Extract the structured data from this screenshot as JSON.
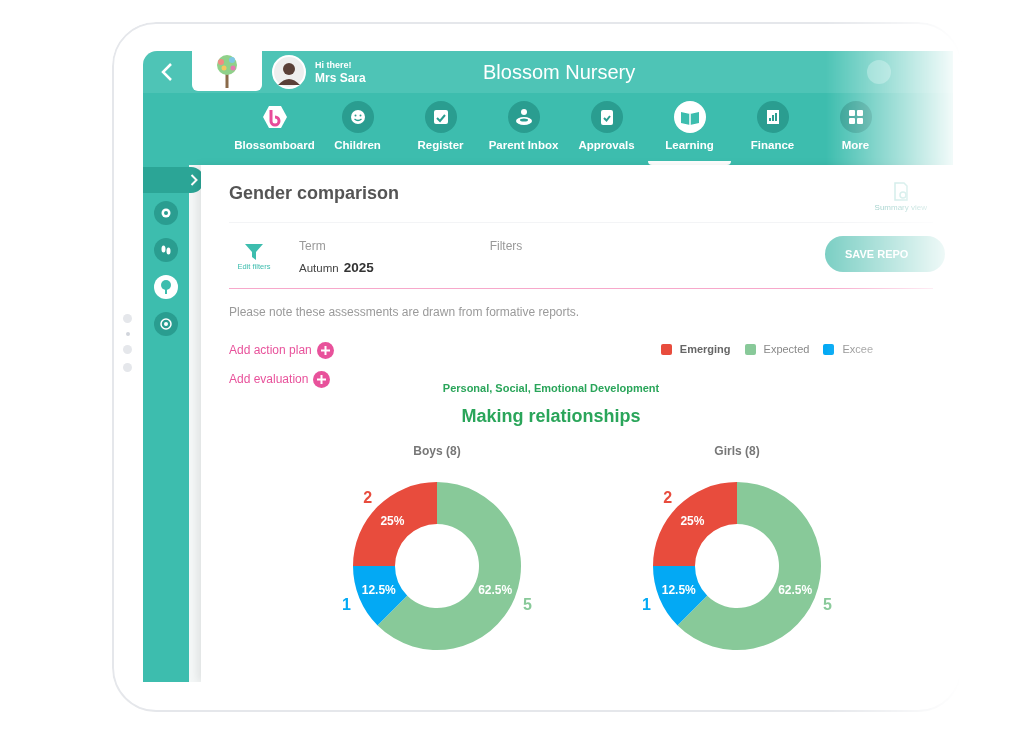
{
  "header": {
    "greeting": "Hi there!",
    "user_name": "Mrs Sara",
    "title": "Blossom Nursery"
  },
  "nav": [
    {
      "label": "Blossomboard",
      "selected": false
    },
    {
      "label": "Children",
      "selected": false
    },
    {
      "label": "Register",
      "selected": false
    },
    {
      "label": "Parent Inbox",
      "selected": false
    },
    {
      "label": "Approvals",
      "selected": false
    },
    {
      "label": "Learning",
      "selected": true
    },
    {
      "label": "Finance",
      "selected": false
    },
    {
      "label": "More",
      "selected": false
    }
  ],
  "sidebar": {
    "items": [
      {
        "selected": false
      },
      {
        "selected": false
      },
      {
        "selected": true
      },
      {
        "selected": false
      }
    ]
  },
  "report": {
    "title": "Gender comparison",
    "summary_label": "Summary view",
    "edit_filters": "Edit filters",
    "term_label": "Term",
    "term_season": "Autumn",
    "term_year": "2025",
    "filters_label": "Filters",
    "save_button": "SAVE REPO",
    "note": "Please note these assessments are drawn from formative reports.",
    "actions": [
      "Add action plan",
      "Add evaluation"
    ],
    "legend": [
      {
        "label": "Emerging",
        "color": "#e84c3d"
      },
      {
        "label": "Expected",
        "color": "#88c999"
      },
      {
        "label": "Excee",
        "color": "#03a9f4"
      }
    ],
    "area": "Personal, Social, Emotional Development",
    "aspect": "Making relationships",
    "charts": [
      {
        "chart_data": {
          "type": "donut",
          "title": "Boys (8)",
          "values": [
            25,
            12.5,
            62.5
          ],
          "colors": [
            "#e84c3d",
            "#03a9f4",
            "#88c999"
          ],
          "value_labels": [
            "25%",
            "12.5%",
            "62.5%"
          ],
          "data_labels": true,
          "annotations": [
            {
              "text": "2"
            },
            {
              "text": "1"
            },
            {
              "text": "5"
            }
          ]
        }
      },
      {
        "chart_data": {
          "type": "donut",
          "title": "Girls (8)",
          "values": [
            25,
            12.5,
            62.5
          ],
          "colors": [
            "#e84c3d",
            "#03a9f4",
            "#88c999"
          ],
          "value_labels": [
            "25%",
            "12.5%",
            "62.5%"
          ],
          "data_labels": true,
          "annotations": [
            {
              "text": "2"
            },
            {
              "text": "1"
            },
            {
              "text": "5"
            }
          ]
        }
      }
    ]
  }
}
